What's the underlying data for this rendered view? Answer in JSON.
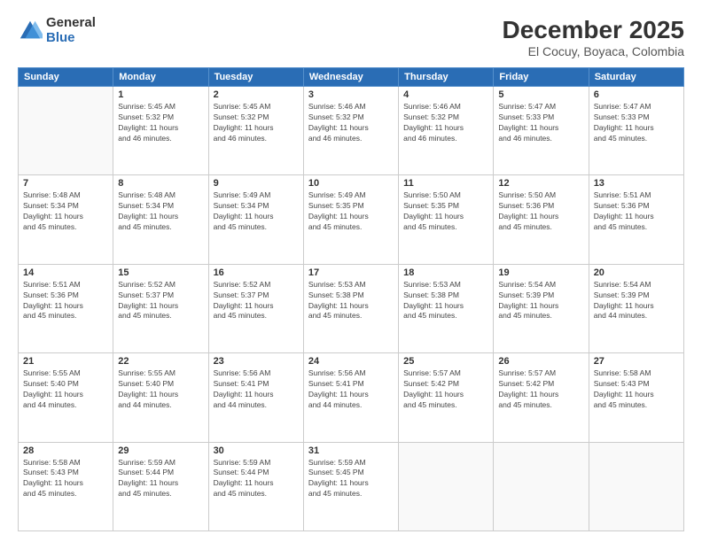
{
  "logo": {
    "general": "General",
    "blue": "Blue"
  },
  "header": {
    "title": "December 2025",
    "subtitle": "El Cocuy, Boyaca, Colombia"
  },
  "weekdays": [
    "Sunday",
    "Monday",
    "Tuesday",
    "Wednesday",
    "Thursday",
    "Friday",
    "Saturday"
  ],
  "weeks": [
    [
      {
        "day": "",
        "info": ""
      },
      {
        "day": "1",
        "info": "Sunrise: 5:45 AM\nSunset: 5:32 PM\nDaylight: 11 hours\nand 46 minutes."
      },
      {
        "day": "2",
        "info": "Sunrise: 5:45 AM\nSunset: 5:32 PM\nDaylight: 11 hours\nand 46 minutes."
      },
      {
        "day": "3",
        "info": "Sunrise: 5:46 AM\nSunset: 5:32 PM\nDaylight: 11 hours\nand 46 minutes."
      },
      {
        "day": "4",
        "info": "Sunrise: 5:46 AM\nSunset: 5:32 PM\nDaylight: 11 hours\nand 46 minutes."
      },
      {
        "day": "5",
        "info": "Sunrise: 5:47 AM\nSunset: 5:33 PM\nDaylight: 11 hours\nand 46 minutes."
      },
      {
        "day": "6",
        "info": "Sunrise: 5:47 AM\nSunset: 5:33 PM\nDaylight: 11 hours\nand 45 minutes."
      }
    ],
    [
      {
        "day": "7",
        "info": "Sunrise: 5:48 AM\nSunset: 5:34 PM\nDaylight: 11 hours\nand 45 minutes."
      },
      {
        "day": "8",
        "info": "Sunrise: 5:48 AM\nSunset: 5:34 PM\nDaylight: 11 hours\nand 45 minutes."
      },
      {
        "day": "9",
        "info": "Sunrise: 5:49 AM\nSunset: 5:34 PM\nDaylight: 11 hours\nand 45 minutes."
      },
      {
        "day": "10",
        "info": "Sunrise: 5:49 AM\nSunset: 5:35 PM\nDaylight: 11 hours\nand 45 minutes."
      },
      {
        "day": "11",
        "info": "Sunrise: 5:50 AM\nSunset: 5:35 PM\nDaylight: 11 hours\nand 45 minutes."
      },
      {
        "day": "12",
        "info": "Sunrise: 5:50 AM\nSunset: 5:36 PM\nDaylight: 11 hours\nand 45 minutes."
      },
      {
        "day": "13",
        "info": "Sunrise: 5:51 AM\nSunset: 5:36 PM\nDaylight: 11 hours\nand 45 minutes."
      }
    ],
    [
      {
        "day": "14",
        "info": "Sunrise: 5:51 AM\nSunset: 5:36 PM\nDaylight: 11 hours\nand 45 minutes."
      },
      {
        "day": "15",
        "info": "Sunrise: 5:52 AM\nSunset: 5:37 PM\nDaylight: 11 hours\nand 45 minutes."
      },
      {
        "day": "16",
        "info": "Sunrise: 5:52 AM\nSunset: 5:37 PM\nDaylight: 11 hours\nand 45 minutes."
      },
      {
        "day": "17",
        "info": "Sunrise: 5:53 AM\nSunset: 5:38 PM\nDaylight: 11 hours\nand 45 minutes."
      },
      {
        "day": "18",
        "info": "Sunrise: 5:53 AM\nSunset: 5:38 PM\nDaylight: 11 hours\nand 45 minutes."
      },
      {
        "day": "19",
        "info": "Sunrise: 5:54 AM\nSunset: 5:39 PM\nDaylight: 11 hours\nand 45 minutes."
      },
      {
        "day": "20",
        "info": "Sunrise: 5:54 AM\nSunset: 5:39 PM\nDaylight: 11 hours\nand 44 minutes."
      }
    ],
    [
      {
        "day": "21",
        "info": "Sunrise: 5:55 AM\nSunset: 5:40 PM\nDaylight: 11 hours\nand 44 minutes."
      },
      {
        "day": "22",
        "info": "Sunrise: 5:55 AM\nSunset: 5:40 PM\nDaylight: 11 hours\nand 44 minutes."
      },
      {
        "day": "23",
        "info": "Sunrise: 5:56 AM\nSunset: 5:41 PM\nDaylight: 11 hours\nand 44 minutes."
      },
      {
        "day": "24",
        "info": "Sunrise: 5:56 AM\nSunset: 5:41 PM\nDaylight: 11 hours\nand 44 minutes."
      },
      {
        "day": "25",
        "info": "Sunrise: 5:57 AM\nSunset: 5:42 PM\nDaylight: 11 hours\nand 45 minutes."
      },
      {
        "day": "26",
        "info": "Sunrise: 5:57 AM\nSunset: 5:42 PM\nDaylight: 11 hours\nand 45 minutes."
      },
      {
        "day": "27",
        "info": "Sunrise: 5:58 AM\nSunset: 5:43 PM\nDaylight: 11 hours\nand 45 minutes."
      }
    ],
    [
      {
        "day": "28",
        "info": "Sunrise: 5:58 AM\nSunset: 5:43 PM\nDaylight: 11 hours\nand 45 minutes."
      },
      {
        "day": "29",
        "info": "Sunrise: 5:59 AM\nSunset: 5:44 PM\nDaylight: 11 hours\nand 45 minutes."
      },
      {
        "day": "30",
        "info": "Sunrise: 5:59 AM\nSunset: 5:44 PM\nDaylight: 11 hours\nand 45 minutes."
      },
      {
        "day": "31",
        "info": "Sunrise: 5:59 AM\nSunset: 5:45 PM\nDaylight: 11 hours\nand 45 minutes."
      },
      {
        "day": "",
        "info": ""
      },
      {
        "day": "",
        "info": ""
      },
      {
        "day": "",
        "info": ""
      }
    ]
  ]
}
